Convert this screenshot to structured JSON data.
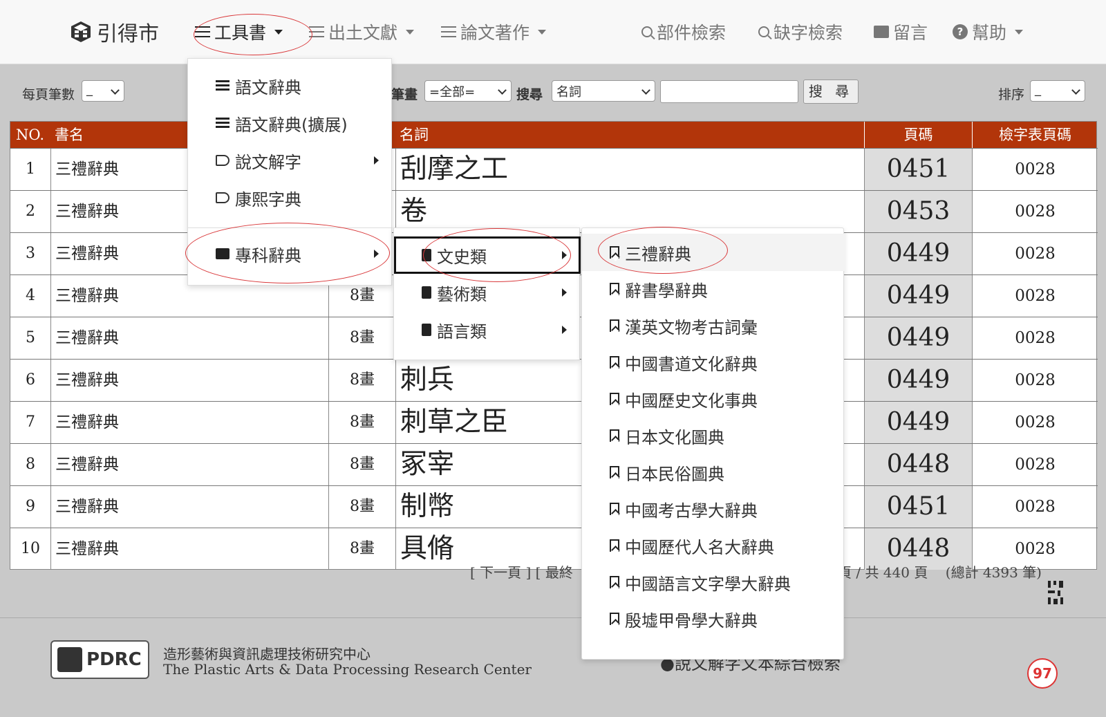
{
  "brand": {
    "title": "引得市",
    "logo_icon": "cube-logo-icon"
  },
  "nav": {
    "items": [
      {
        "label": "工具書",
        "icon": "menu-icon",
        "dropdown": true
      },
      {
        "label": "出土文獻",
        "icon": "menu-icon",
        "dropdown": true
      },
      {
        "label": "論文著作",
        "icon": "menu-icon",
        "dropdown": true
      },
      {
        "label": "部件檢索",
        "icon": "search-icon"
      },
      {
        "label": "缺字檢索",
        "icon": "search-icon"
      },
      {
        "label": "留言",
        "icon": "comment-icon"
      },
      {
        "label": "幫助",
        "icon": "help-icon",
        "dropdown": true
      }
    ]
  },
  "filters": {
    "per_page_label": "每頁筆數",
    "per_page_value": "_",
    "strokes_label": "筆畫",
    "strokes_value": "=全部=",
    "search_label": "搜尋",
    "search_field_value": "名詞",
    "search_input_value": "",
    "search_button": "搜 尋",
    "sort_label": "排序",
    "sort_value": "_"
  },
  "table": {
    "headers": [
      "NO.",
      "書名",
      "名詞",
      "頁碼",
      "檢字表頁碼"
    ],
    "rows": [
      {
        "no": "1",
        "book": "三禮辭典",
        "strokes": "",
        "term": "刮摩之工",
        "page": "0451",
        "index_page": "0028"
      },
      {
        "no": "2",
        "book": "三禮辭典",
        "strokes": "",
        "term": "卷",
        "page": "0453",
        "index_page": "0028"
      },
      {
        "no": "3",
        "book": "三禮辭典",
        "strokes": "",
        "term": "",
        "page": "0449",
        "index_page": "0028"
      },
      {
        "no": "4",
        "book": "三禮辭典",
        "strokes": "8畫",
        "term": "",
        "page": "0449",
        "index_page": "0028"
      },
      {
        "no": "5",
        "book": "三禮辭典",
        "strokes": "8畫",
        "term": "",
        "page": "0449",
        "index_page": "0028"
      },
      {
        "no": "6",
        "book": "三禮辭典",
        "strokes": "8畫",
        "term": "刺兵",
        "page": "0449",
        "index_page": "0028"
      },
      {
        "no": "7",
        "book": "三禮辭典",
        "strokes": "8畫",
        "term": "刺草之臣",
        "page": "0449",
        "index_page": "0028"
      },
      {
        "no": "8",
        "book": "三禮辭典",
        "strokes": "8畫",
        "term": "冢宰",
        "page": "0448",
        "index_page": "0028"
      },
      {
        "no": "9",
        "book": "三禮辭典",
        "strokes": "8畫",
        "term": "制幣",
        "page": "0451",
        "index_page": "0028"
      },
      {
        "no": "10",
        "book": "三禮辭典",
        "strokes": "8畫",
        "term": "具脩",
        "page": "0448",
        "index_page": "0028"
      }
    ]
  },
  "pager": {
    "left": "[ 下一頁 ] [ 最終",
    "right": "頁 / 共 440 頁    (總計 4393 筆)"
  },
  "menu_tools": {
    "items": [
      {
        "label": "語文辭典",
        "icon": "list-icon",
        "submenu": false
      },
      {
        "label": "語文辭典(擴展)",
        "icon": "list-icon",
        "submenu": false
      },
      {
        "label": "說文解字",
        "icon": "tag-icon",
        "submenu": true
      },
      {
        "label": "康熙字典",
        "icon": "tag-icon",
        "submenu": false
      },
      {
        "label": "專科辭典",
        "icon": "books-icon",
        "submenu": true
      }
    ]
  },
  "menu_specialty": {
    "items": [
      {
        "label": "文史類",
        "icon": "book-icon"
      },
      {
        "label": "藝術類",
        "icon": "book-icon"
      },
      {
        "label": "語言類",
        "icon": "book-icon"
      }
    ]
  },
  "menu_history": {
    "items": [
      "三禮辭典",
      "辭書學辭典",
      "漢英文物考古詞彙",
      "中國書道文化辭典",
      "中國歷史文化事典",
      "日本文化圖典",
      "日本民俗圖典",
      "中國考古學大辭典",
      "中國歷代人名大辭典",
      "中國語言文字學大辭典",
      "殷墟甲骨學大辭典"
    ]
  },
  "footer": {
    "logo_text": "PDRC",
    "org_cn": "造形藝術與資訊處理技術研究中心",
    "org_en": "The Plastic Arts & Data Processing Research Center",
    "link": "●說文解字文本綜合檢索",
    "badge": "97"
  },
  "colors": {
    "header_bg": "#b2350a",
    "annotation": "#d9383a",
    "page_col_bg": "#dddddd"
  }
}
